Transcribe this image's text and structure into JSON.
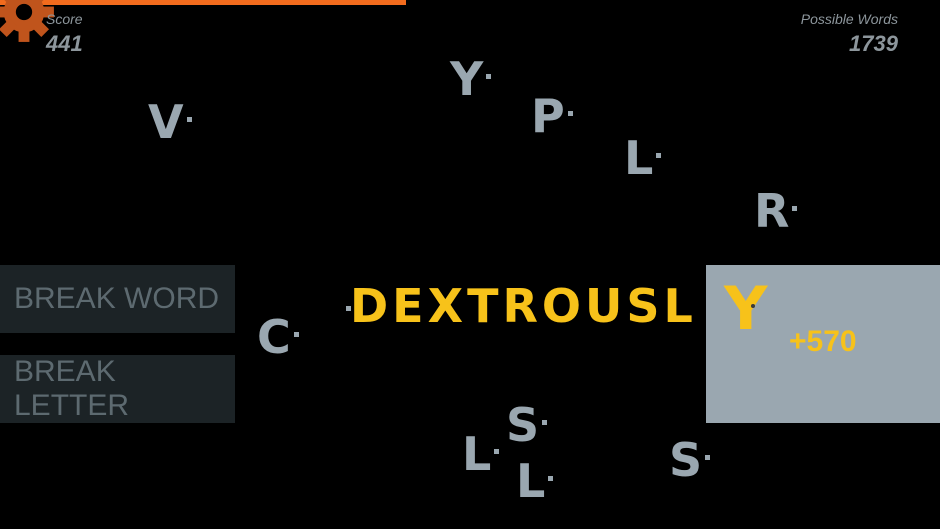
{
  "progress": {
    "fraction": 0.432,
    "color": "#f26b1d"
  },
  "settings": {
    "icon": "gear-icon",
    "color": "#c0541c"
  },
  "hud": {
    "score_label": "Score",
    "score_value": "441",
    "possible_label": "Possible Words",
    "possible_value": "1739"
  },
  "buttons": {
    "break_word": "BREAK WORD",
    "break_letter": "BREAK LETTER"
  },
  "current_word": {
    "text": "DEXTROUSL",
    "last_letter": "Y",
    "points": "+570",
    "color": "#f7c21a"
  },
  "floating_letters": [
    {
      "char": "Y"
    },
    {
      "char": "V"
    },
    {
      "char": "P"
    },
    {
      "char": "L"
    },
    {
      "char": "R"
    },
    {
      "char": "C"
    },
    {
      "char": "S"
    },
    {
      "char": "L"
    },
    {
      "char": "L"
    },
    {
      "char": "S"
    }
  ]
}
